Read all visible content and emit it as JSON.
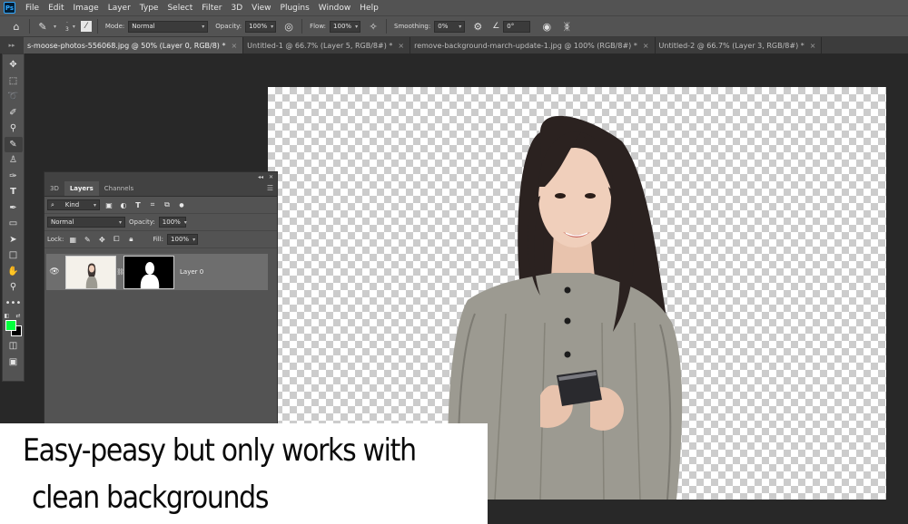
{
  "menubar": {
    "logo": "Ps",
    "items": [
      "File",
      "Edit",
      "Image",
      "Layer",
      "Type",
      "Select",
      "Filter",
      "3D",
      "View",
      "Plugins",
      "Window",
      "Help"
    ]
  },
  "options_bar": {
    "brush_size": "3",
    "mode_label": "Mode:",
    "mode_value": "Normal",
    "opacity_label": "Opacity:",
    "opacity_value": "100%",
    "flow_label": "Flow:",
    "flow_value": "100%",
    "smoothing_label": "Smoothing:",
    "smoothing_value": "0%",
    "angle_value": "0°"
  },
  "tabs": [
    {
      "label": "s-moose-photos-556068.jpg @ 50% (Layer 0, RGB/8) *",
      "close": "×"
    },
    {
      "label": "Untitled-1 @ 66.7% (Layer 5, RGB/8#) *",
      "close": "×"
    },
    {
      "label": "remove-background-march-update-1.jpg @ 100% (RGB/8#) *",
      "close": "×"
    },
    {
      "label": "Untitled-2 @ 66.7% (Layer 3, RGB/8#) *",
      "close": "×"
    }
  ],
  "toolbar": {
    "tools": [
      "move-tool",
      "marquee-tool",
      "lasso-tool",
      "quick-selection-tool",
      "eyedropper-tool",
      "brush-tool",
      "stamp-tool",
      "history-brush-tool",
      "type-tool",
      "pen-tool",
      "gradient-tool",
      "path-selection-tool",
      "rectangle-tool",
      "hand-tool",
      "zoom-tool",
      "more-tools"
    ],
    "foreground_color": "#00ff3c",
    "background_color": "#000000"
  },
  "layers_panel": {
    "tabs": [
      "3D",
      "Layers",
      "Channels"
    ],
    "active_tab": "Layers",
    "filter_kind": "Kind",
    "blend_mode": "Normal",
    "opacity_label": "Opacity:",
    "opacity_value": "100%",
    "lock_label": "Lock:",
    "fill_label": "Fill:",
    "fill_value": "100%",
    "layers": [
      {
        "name": "Layer 0",
        "visible": true,
        "has_mask": true
      }
    ]
  },
  "caption": {
    "line1": "Easy-peasy but only works with",
    "line2": "clean backgrounds"
  }
}
